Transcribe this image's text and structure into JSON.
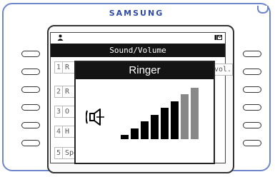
{
  "device": {
    "brand": "SAMSUNG",
    "status_left_icon": "person-icon",
    "status_right_icon": "message-icon"
  },
  "screen": {
    "title": "Sound/Volume",
    "menu": [
      {
        "num": "1",
        "label": "R"
      },
      {
        "num": "2",
        "label": "R"
      },
      {
        "num": "3",
        "label": "O"
      },
      {
        "num": "4",
        "label": "H"
      },
      {
        "num": "5",
        "label": "Speaker vol."
      }
    ],
    "overflow_label": "vol."
  },
  "popup": {
    "title": "Ringer",
    "icon": "speaker-icon",
    "volume_level": 6,
    "volume_max": 8,
    "active_color": "#000000",
    "inactive_color": "#888888"
  }
}
